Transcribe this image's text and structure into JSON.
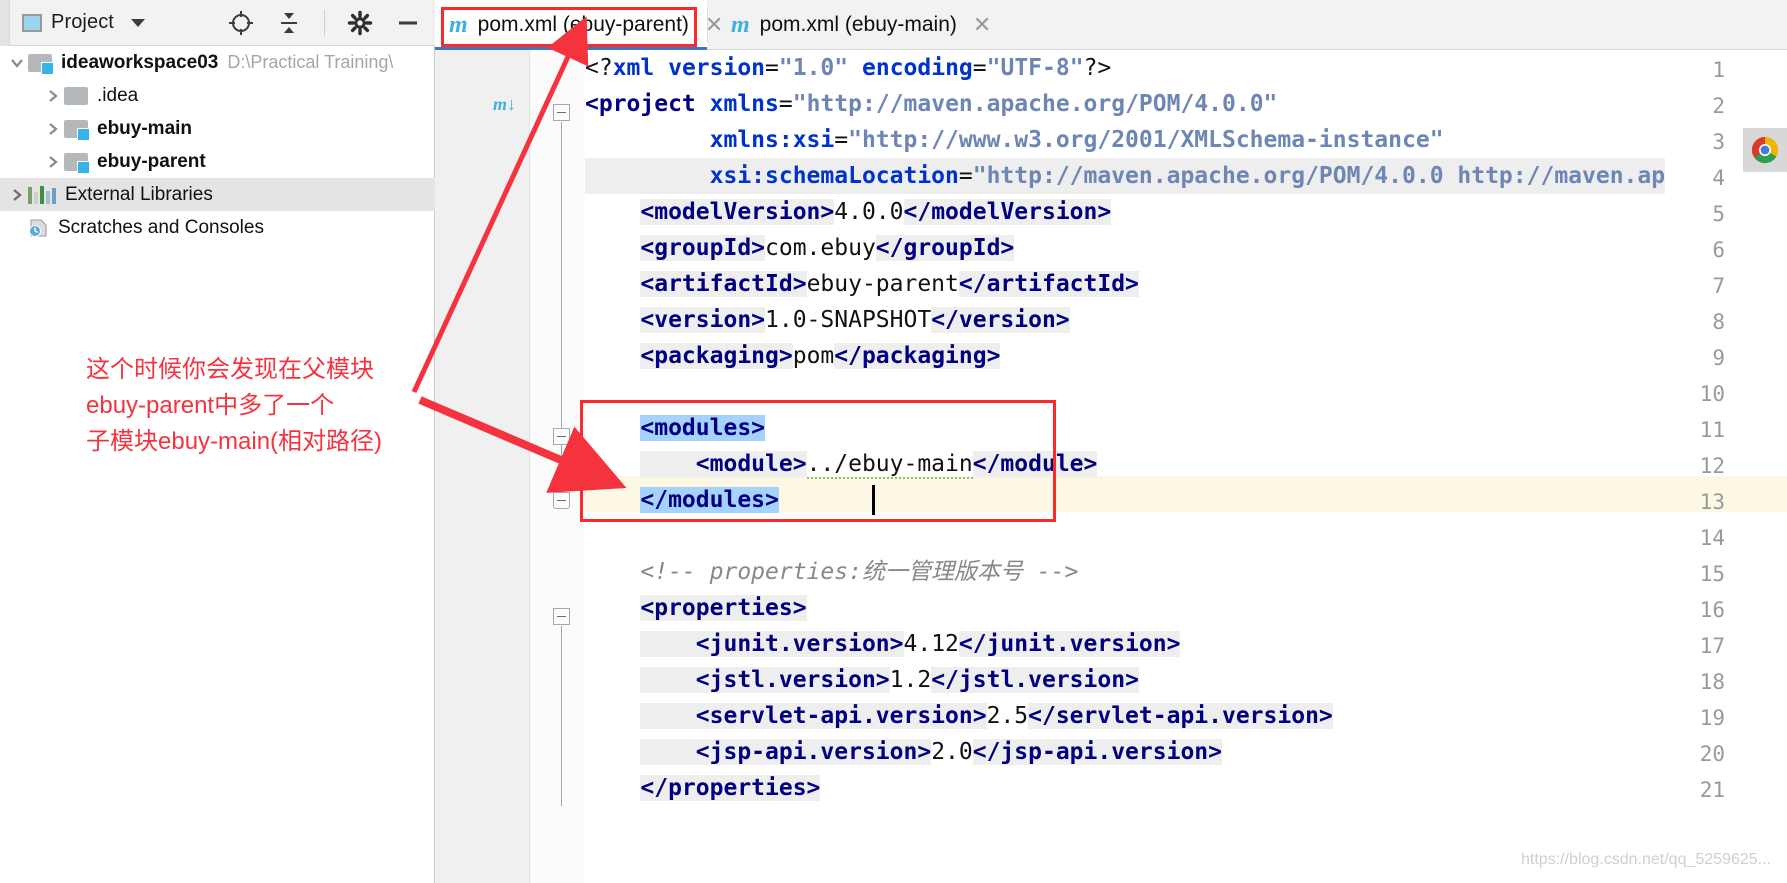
{
  "window": {
    "app": "IntelliJ IDEA",
    "accent_blue": "#3c76c8",
    "annotation_red": "#fb2a2a"
  },
  "sidebar": {
    "title": "Project",
    "icons": [
      {
        "name": "locate-icon",
        "glyph": "⊕"
      },
      {
        "name": "collapse-all-icon",
        "glyph": "⇵"
      },
      {
        "name": "settings-gear-icon",
        "glyph": "⚙"
      },
      {
        "name": "minimize-icon",
        "glyph": "—"
      }
    ],
    "tree": [
      {
        "label": "ideaworkspace03",
        "path": "D:\\Practical Training\\",
        "depth": 0,
        "expanded": true,
        "kind": "module",
        "bold": true
      },
      {
        "label": ".idea",
        "path": "",
        "depth": 1,
        "expanded": false,
        "kind": "folder",
        "bold": false
      },
      {
        "label": "ebuy-main",
        "path": "",
        "depth": 1,
        "expanded": false,
        "kind": "module",
        "bold": true
      },
      {
        "label": "ebuy-parent",
        "path": "",
        "depth": 1,
        "expanded": false,
        "kind": "module",
        "bold": true
      },
      {
        "label": "External Libraries",
        "path": "",
        "depth": 0,
        "expanded": false,
        "kind": "libraries",
        "bold": false
      },
      {
        "label": "Scratches and Consoles",
        "path": "",
        "depth": 0,
        "expanded": null,
        "kind": "scratches",
        "bold": false
      }
    ]
  },
  "tabs": [
    {
      "label": "pom.xml (ebuy-parent)",
      "icon": "maven-m-icon",
      "active": true,
      "closable": true,
      "highlighted": true
    },
    {
      "label": "pom.xml (ebuy-main)",
      "icon": "maven-m-icon",
      "active": false,
      "closable": true,
      "highlighted": false
    }
  ],
  "editor": {
    "file": "pom.xml (ebuy-parent)",
    "cursor_line": 13,
    "selection": [
      "<modules>",
      "</modules>"
    ],
    "lines": [
      {
        "n": 1,
        "text": "<?xml version=\"1.0\" encoding=\"UTF-8\"?>"
      },
      {
        "n": 2,
        "text": "<project xmlns=\"http://maven.apache.org/POM/4.0.0\"",
        "marker": "m"
      },
      {
        "n": 3,
        "text": "         xmlns:xsi=\"http://www.w3.org/2001/XMLSchema-instance\""
      },
      {
        "n": 4,
        "text": "         xsi:schemaLocation=\"http://maven.apache.org/POM/4.0.0 http://maven.ap"
      },
      {
        "n": 5,
        "text": "    <modelVersion>4.0.0</modelVersion>"
      },
      {
        "n": 6,
        "text": "    <groupId>com.ebuy</groupId>"
      },
      {
        "n": 7,
        "text": "    <artifactId>ebuy-parent</artifactId>"
      },
      {
        "n": 8,
        "text": "    <version>1.0-SNAPSHOT</version>"
      },
      {
        "n": 9,
        "text": "    <packaging>pom</packaging>"
      },
      {
        "n": 10,
        "text": ""
      },
      {
        "n": 11,
        "text": "    <modules>"
      },
      {
        "n": 12,
        "text": "        <module>../ebuy-main</module>"
      },
      {
        "n": 13,
        "text": "    </modules>"
      },
      {
        "n": 14,
        "text": ""
      },
      {
        "n": 15,
        "text": "    <!-- properties:统一管理版本号 -->"
      },
      {
        "n": 16,
        "text": "    <properties>"
      },
      {
        "n": 17,
        "text": "        <junit.version>4.12</junit.version>"
      },
      {
        "n": 18,
        "text": "        <jstl.version>1.2</jstl.version>"
      },
      {
        "n": 19,
        "text": "        <servlet-api.version>2.5</servlet-api.version>"
      },
      {
        "n": 20,
        "text": "        <jsp-api.version>2.0</jsp-api.version>"
      },
      {
        "n": 21,
        "text": "    </properties>"
      }
    ]
  },
  "annotation": {
    "line1": "这个时候你会发现在父模块",
    "line2": "ebuy-parent中多了一个",
    "line3": "子模块ebuy-main(相对路径)"
  },
  "watermark": "https://blog.csdn.net/qq_5259625...",
  "chrome_icon": "chrome-browser-icon"
}
